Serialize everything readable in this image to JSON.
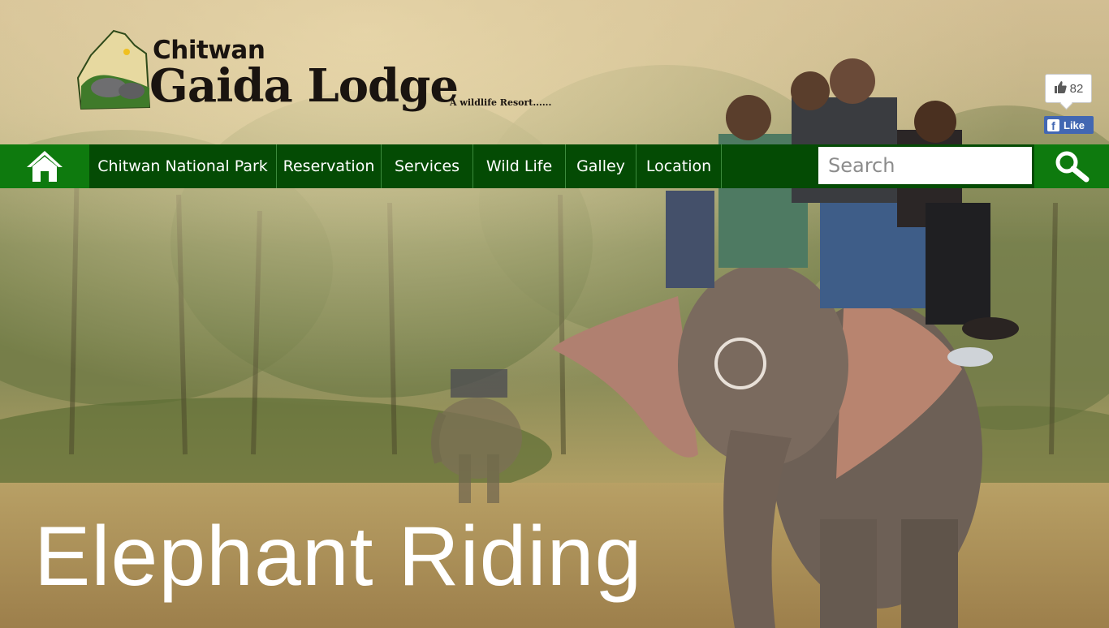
{
  "logo": {
    "line1": "Chitwan",
    "line2": "Gaida Lodge",
    "tagline": "A wildlife Resort......"
  },
  "facebook": {
    "like_count": "82",
    "like_label": "Like"
  },
  "nav": {
    "items": [
      {
        "label": "Chitwan National Park"
      },
      {
        "label": "Reservation"
      },
      {
        "label": "Services"
      },
      {
        "label": "Wild Life"
      },
      {
        "label": "Galley"
      },
      {
        "label": "Location"
      }
    ]
  },
  "search": {
    "placeholder": "Search"
  },
  "hero": {
    "headline": "Elephant Riding"
  },
  "colors": {
    "nav_green": "#0d6d0d",
    "nav_dark": "#044b04",
    "fb_blue": "#4267b2"
  }
}
